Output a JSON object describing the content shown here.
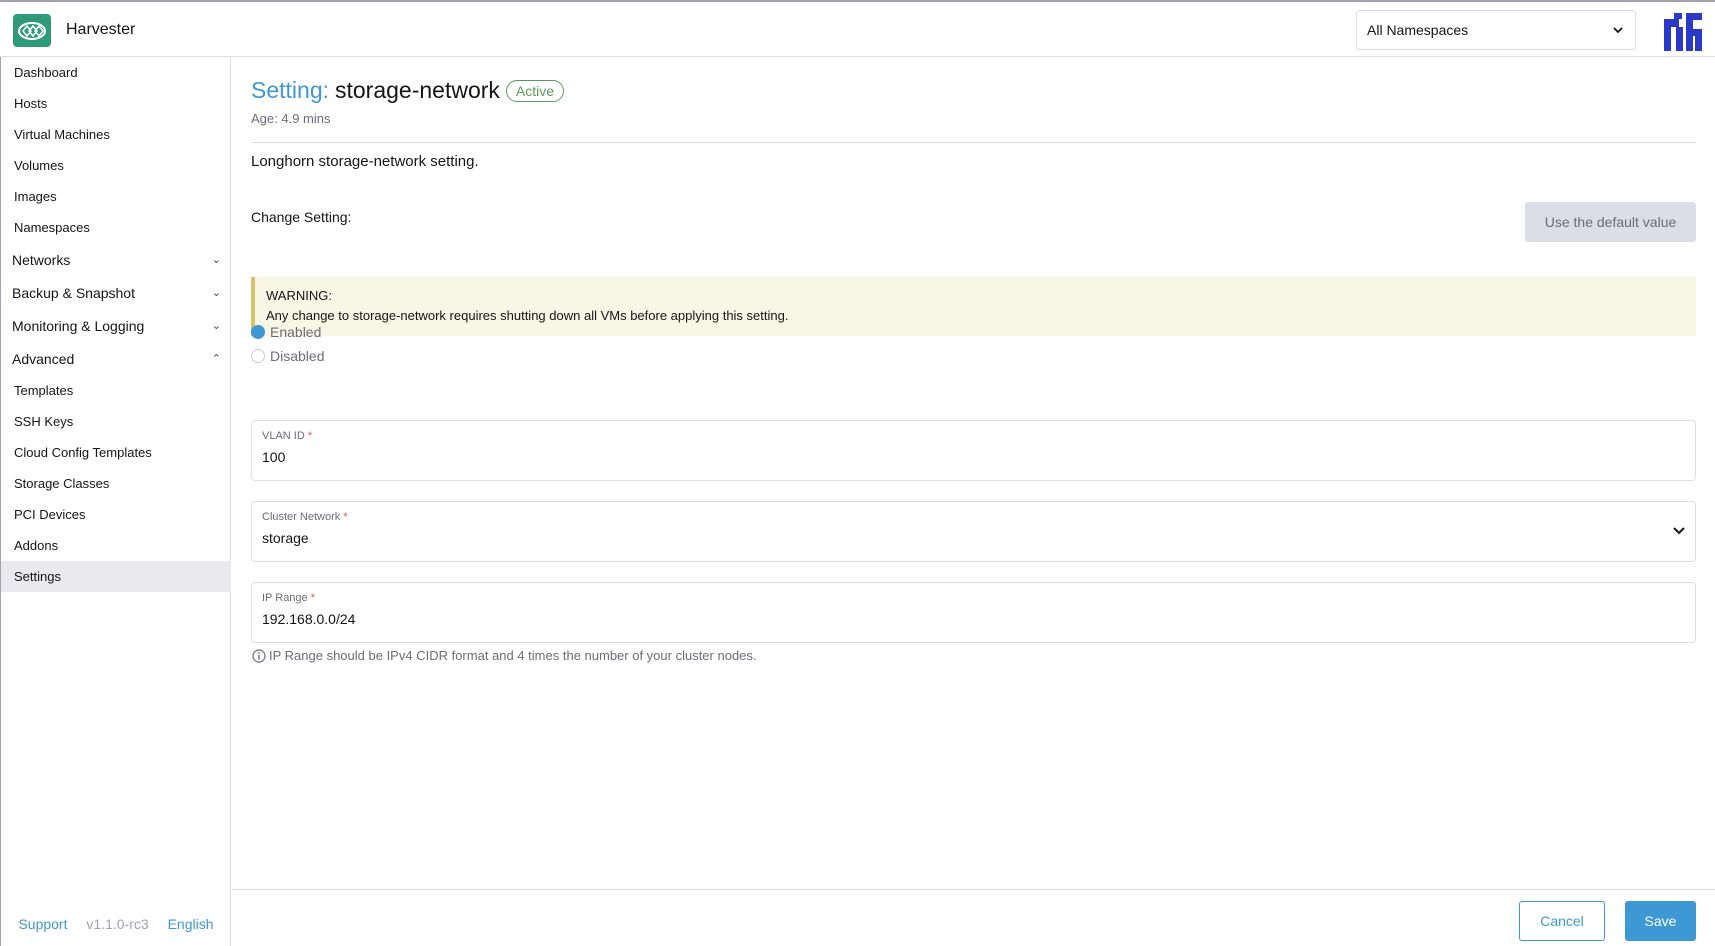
{
  "header": {
    "app_title": "Harvester",
    "namespace_select": "All Namespaces"
  },
  "sidebar": {
    "items": [
      {
        "label": "Dashboard"
      },
      {
        "label": "Hosts"
      },
      {
        "label": "Virtual Machines"
      },
      {
        "label": "Volumes"
      },
      {
        "label": "Images"
      },
      {
        "label": "Namespaces"
      },
      {
        "label": "Networks"
      },
      {
        "label": "Backup & Snapshot"
      },
      {
        "label": "Monitoring & Logging"
      },
      {
        "label": "Advanced"
      },
      {
        "label": "Templates"
      },
      {
        "label": "SSH Keys"
      },
      {
        "label": "Cloud Config Templates"
      },
      {
        "label": "Storage Classes"
      },
      {
        "label": "PCI Devices"
      },
      {
        "label": "Addons"
      },
      {
        "label": "Settings"
      }
    ],
    "footer": {
      "support": "Support",
      "version": "v1.1.0-rc3",
      "language": "English"
    }
  },
  "main": {
    "title_prefix": "Setting:",
    "title_name": "storage-network",
    "status_badge": "Active",
    "age": "Age: 4.9 mins",
    "description": "Longhorn storage-network setting.",
    "change_setting_label": "Change Setting:",
    "default_button": "Use the default value",
    "warning": {
      "title": "WARNING:",
      "text": "Any change to storage-network requires shutting down all VMs before applying this setting."
    },
    "radio": {
      "enabled": "Enabled",
      "disabled": "Disabled",
      "selected": "Enabled"
    },
    "fields": {
      "vlan": {
        "label": "VLAN ID",
        "required": "*",
        "value": "100"
      },
      "cluster_network": {
        "label": "Cluster Network",
        "required": "*",
        "value": "storage"
      },
      "ip_range": {
        "label": "IP Range",
        "required": "*",
        "value": "192.168.0.0/24"
      }
    },
    "hint": "IP Range should be IPv4 CIDR format and 4 times the number of your cluster nodes."
  },
  "footer": {
    "cancel": "Cancel",
    "save": "Save"
  },
  "colors": {
    "accent": "#3d98d3",
    "brand": "#2f9a78",
    "active_badge": "#5d995d",
    "warning_bg": "#f8f6e4"
  }
}
